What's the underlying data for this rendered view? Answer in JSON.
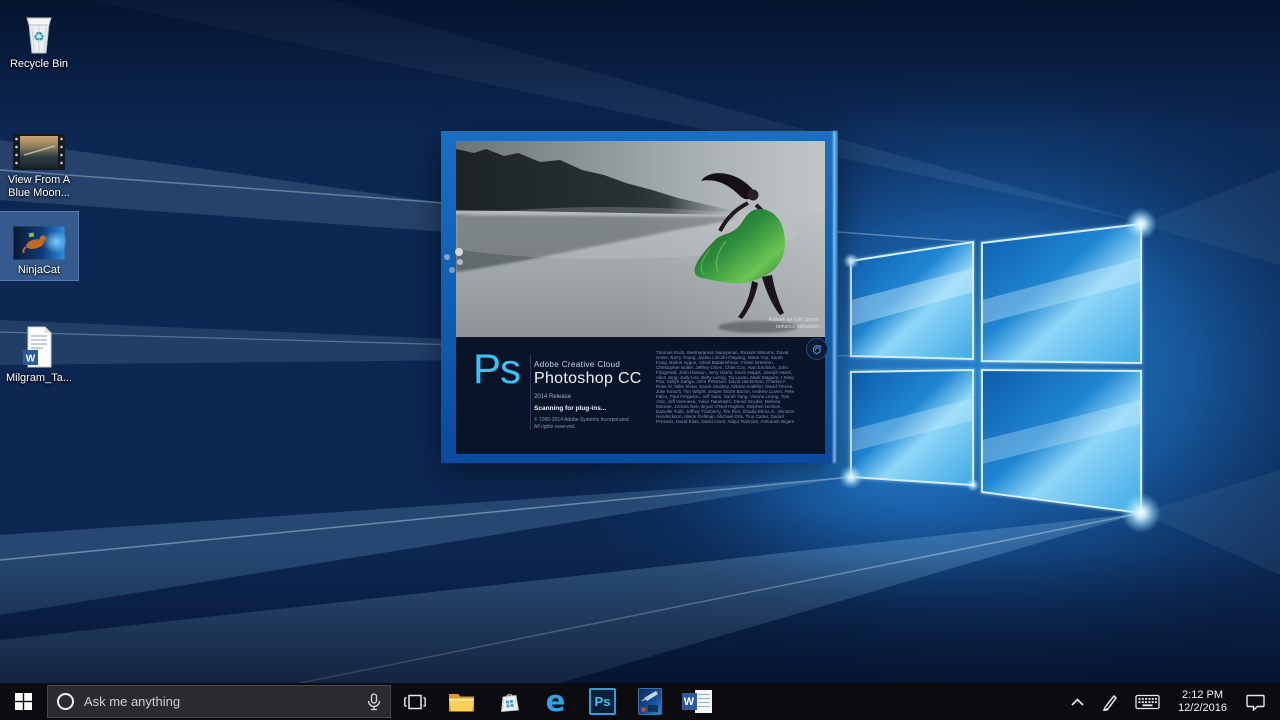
{
  "desktop": {
    "icons": [
      {
        "label": "Recycle Bin"
      },
      {
        "label": "View From A Blue Moon..."
      },
      {
        "label": "NinjaCat",
        "selected": true
      },
      {
        "label": "Milgram_Ta..."
      }
    ]
  },
  "splash": {
    "app_initials": "Ps",
    "brand": "Adobe Creative Cloud",
    "product": "Photoshop CC",
    "release": "2014 Release",
    "status": "Scanning for plug-ins...",
    "copyright_line1": "© 1990-2014 Adobe Systems Incorporated.",
    "copyright_line2": "All rights reserved.",
    "artwork_credit_line1": "Artwork by Kylli Sparre",
    "artwork_credit_line2": "behance.net/adobe",
    "credits": "Thomas Knoll, Seetharaman Narayanan, Russell Williams, David Howe, Barry Young, Jackie Lincoln-Owyang, Maria Yap, Sarah Kong, Barkin Aygun, Vinod Balakrishnan, Foster Brereton, Christopher Butler, Jeffrey Chien, Chris Cox, Alan Erickson, John Fitzgerald, John Hanson, Jerry Harris, Kevin Hopps, Joseph Hsieh, Allen Jeng, Judy Lee, Betty Leong, Tai Luxon, Mark Maguire, I-Ming Pao, Kellyn Sanga, John Peterson, David Hackerson, Charles F. Rose III, Mike Shaw, Sarah Stuckey, Nikolai Svakhin, David Trevas, Julie Kmoch, Tim Wright, Jesper Storm Bache, Andrew Coven, Pete Falco, Paul Ferguson, Jeff Sass, Sarah Yang, Vienna Leung, Tom Attix, Jeff Vienneau, Yukie Takahashi, Daniel Snyder, Melissa Monroe, Zorana Gee, Bryan O'Neil Hughes, Stephen Nielson, Danielle Tullo, Jeffrey Tranberry, Tim Riot, Shadia Elena S., Winston Hendrickson, Alison Gellman, Michael Orts, Tino Carter, Daniel Presedo, David Elias, David Hoerl, Atiqur Rahman, Ashutosh Nigam"
  },
  "taskbar": {
    "search_placeholder": "Ask me anything"
  },
  "glyphs": {
    "recycle": "♻",
    "edge": "e",
    "photoshop_tile": "Ps",
    "word": "W"
  },
  "tray": {
    "time": "2:12 PM",
    "date": "12/2/2016"
  },
  "colors": {
    "accent_cyan": "#31c5f0",
    "selection_blue": "#699bd7",
    "taskbar_bg": "#0c0c10",
    "splash_panel": "#0a1428",
    "frame_blue": "#1160b2"
  }
}
